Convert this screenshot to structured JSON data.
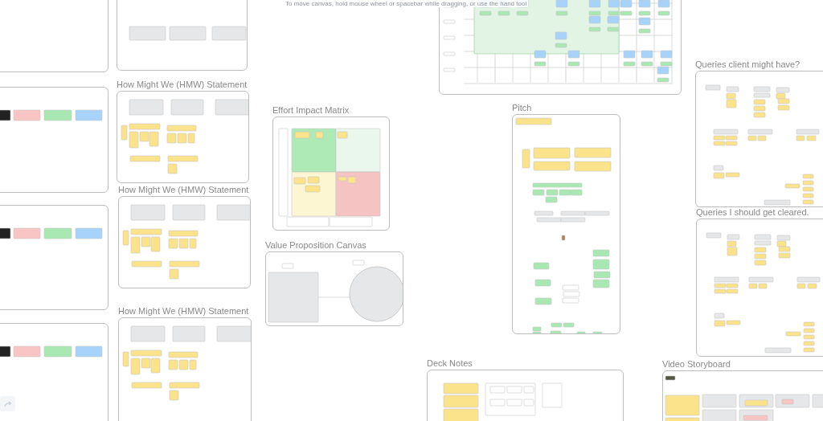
{
  "hint": "To move canvas, hold mouse wheel or spacebar while dragging, or use the hand tool",
  "frames": [
    {
      "kind": "blank"
    },
    {
      "kind": "flow"
    },
    {
      "kind": "journey"
    },
    {
      "kind": "legend"
    },
    {
      "kind": "hmw",
      "title": "How Might We (HMW) Statement"
    },
    {
      "kind": "matrix",
      "title": "Effort Impact Matrix"
    },
    {
      "kind": "pitch",
      "title": "Pitch"
    },
    {
      "kind": "queries",
      "title": "Queries client might have?"
    },
    {
      "kind": "legend"
    },
    {
      "kind": "hmw",
      "title": "How Might We (HMW) Statement"
    },
    {
      "kind": "vpc",
      "title": "Value Proposition Canvas"
    },
    {
      "kind": "queries",
      "title": "Queries I should get cleared."
    },
    {
      "kind": "legend"
    },
    {
      "kind": "hmw",
      "title": "How Might We (HMW) Statement"
    },
    {
      "kind": "notes",
      "title": "Deck Notes"
    },
    {
      "kind": "storyboard",
      "title": "Video Storyboard"
    }
  ]
}
